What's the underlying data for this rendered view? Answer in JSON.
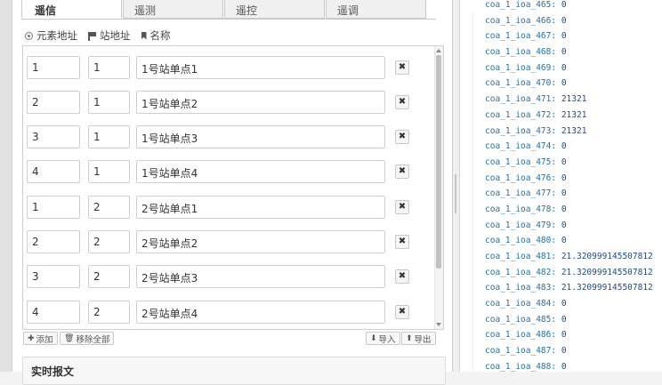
{
  "tabs": [
    {
      "label": "遥信",
      "active": true
    },
    {
      "label": "遥测",
      "active": false
    },
    {
      "label": "遥控",
      "active": false
    },
    {
      "label": "遥调",
      "active": false
    }
  ],
  "legend": {
    "element_address": "元素地址",
    "station_address": "站地址",
    "name": "名称"
  },
  "rows": [
    {
      "element": "1",
      "station": "1",
      "name": "1号站单点1"
    },
    {
      "element": "2",
      "station": "1",
      "name": "1号站单点2"
    },
    {
      "element": "3",
      "station": "1",
      "name": "1号站单点3"
    },
    {
      "element": "4",
      "station": "1",
      "name": "1号站单点4"
    },
    {
      "element": "1",
      "station": "2",
      "name": "2号站单点1"
    },
    {
      "element": "2",
      "station": "2",
      "name": "2号站单点2"
    },
    {
      "element": "3",
      "station": "2",
      "name": "2号站单点3"
    },
    {
      "element": "4",
      "station": "2",
      "name": "2号站单点4"
    }
  ],
  "delete_glyph": "✖",
  "buttons": {
    "add": "添加",
    "remove_all": "移除全部",
    "import": "导入",
    "export": "导出"
  },
  "section": {
    "title": "实时报文"
  },
  "debug_lines": [
    {
      "key": "coa_1_ioa_465:",
      "value": "0"
    },
    {
      "key": "coa_1_ioa_466:",
      "value": "0"
    },
    {
      "key": "coa_1_ioa_467:",
      "value": "0"
    },
    {
      "key": "coa_1_ioa_468:",
      "value": "0"
    },
    {
      "key": "coa_1_ioa_469:",
      "value": "0"
    },
    {
      "key": "coa_1_ioa_470:",
      "value": "0"
    },
    {
      "key": "coa_1_ioa_471:",
      "value": "21321"
    },
    {
      "key": "coa_1_ioa_472:",
      "value": "21321"
    },
    {
      "key": "coa_1_ioa_473:",
      "value": "21321"
    },
    {
      "key": "coa_1_ioa_474:",
      "value": "0"
    },
    {
      "key": "coa_1_ioa_475:",
      "value": "0"
    },
    {
      "key": "coa_1_ioa_476:",
      "value": "0"
    },
    {
      "key": "coa_1_ioa_477:",
      "value": "0"
    },
    {
      "key": "coa_1_ioa_478:",
      "value": "0"
    },
    {
      "key": "coa_1_ioa_479:",
      "value": "0"
    },
    {
      "key": "coa_1_ioa_480:",
      "value": "0"
    },
    {
      "key": "coa_1_ioa_481:",
      "value": "21.320999145507812"
    },
    {
      "key": "coa_1_ioa_482:",
      "value": "21.320999145507812"
    },
    {
      "key": "coa_1_ioa_483:",
      "value": "21.320999145507812"
    },
    {
      "key": "coa_1_ioa_484:",
      "value": "0"
    },
    {
      "key": "coa_1_ioa_485:",
      "value": "0"
    },
    {
      "key": "coa_1_ioa_486:",
      "value": "0"
    },
    {
      "key": "coa_1_ioa_487:",
      "value": "0"
    },
    {
      "key": "coa_1_ioa_488:",
      "value": "0"
    }
  ],
  "colors": {
    "debug_key": "#2a6f9c",
    "debug_value": "#1f4a8a",
    "border": "#cfcfcf"
  }
}
